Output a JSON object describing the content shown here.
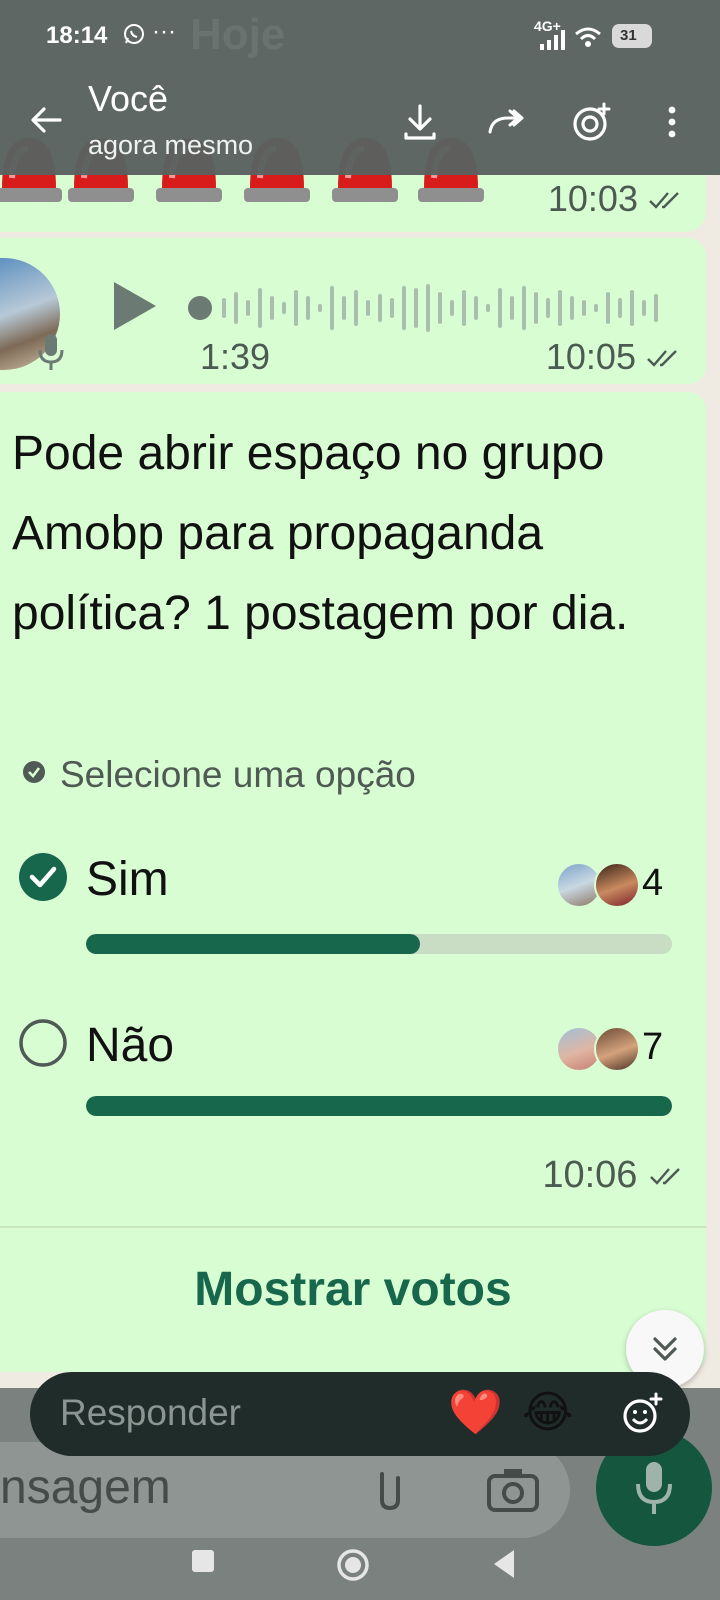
{
  "status_bar": {
    "time": "18:14",
    "more": "···",
    "network": "4G+",
    "battery": "31"
  },
  "date_chip": "Hoje",
  "header": {
    "title": "Você",
    "subtitle": "agora mesmo",
    "icons": [
      "back-arrow-icon",
      "download-icon",
      "forward-icon",
      "add-status-icon",
      "more-vertical-icon"
    ]
  },
  "messages": [
    {
      "type": "stickers",
      "time": "10:03",
      "status": "read"
    },
    {
      "type": "audio",
      "duration": "1:39",
      "time": "10:05",
      "status": "read"
    },
    {
      "type": "poll",
      "question": "Pode abrir espaço no grupo Amobp para propaganda política? 1 postagem por dia.",
      "hint": "Selecione uma opção",
      "options": [
        {
          "label": "Sim",
          "votes": "4",
          "fraction": 0.57,
          "selected": true
        },
        {
          "label": "Não",
          "votes": "7",
          "fraction": 1.0,
          "selected": false
        }
      ],
      "time": "10:06",
      "status": "read",
      "action": "Mostrar votos"
    }
  ],
  "composer": {
    "placeholder_partial": "nsagem"
  },
  "reply_bar": {
    "placeholder": "Responder",
    "reactions": [
      "❤️",
      "😂"
    ]
  },
  "colors": {
    "bubble_outgoing": "#d9fdd3",
    "accent_green": "#17674d",
    "header_overlay": "#5a6260"
  }
}
